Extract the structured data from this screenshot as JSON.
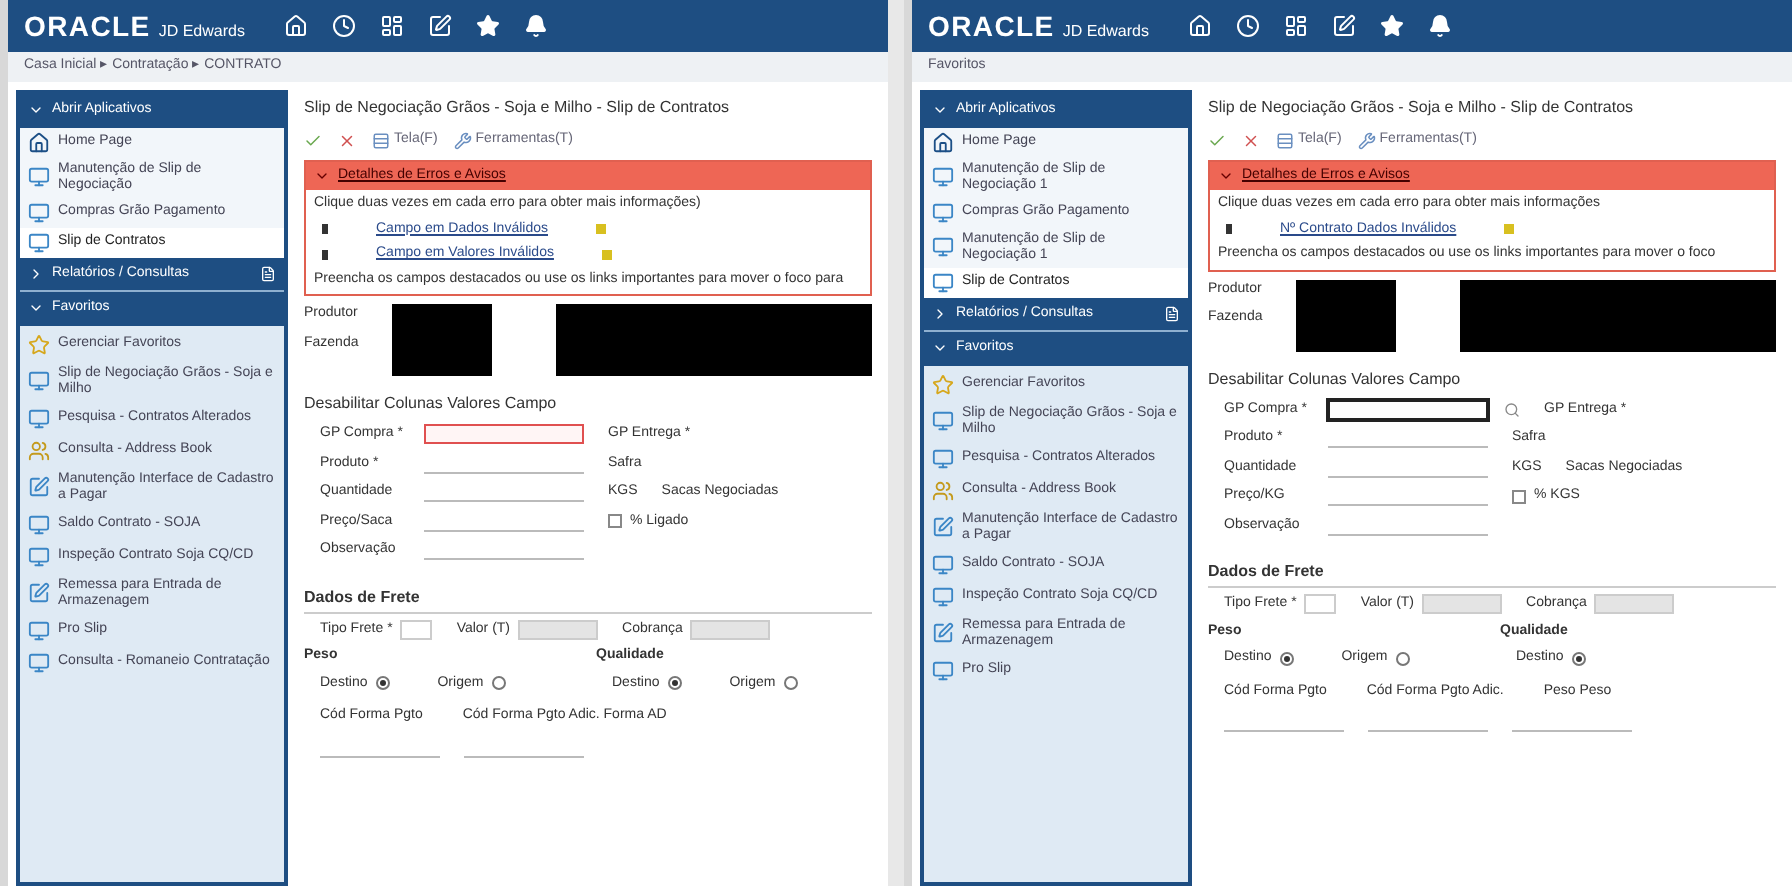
{
  "windows": [
    {
      "logo": {
        "brand": "ORACLE",
        "product": "JD Edwards"
      },
      "breadcrumb": "Casa Inicial ▸ Contratação ▸ CONTRATO",
      "sidebar": {
        "open_apps": {
          "title": "Abrir Aplicativos",
          "items": [
            {
              "label": "Home Page",
              "kind": "home",
              "selected": false
            },
            {
              "label": "Manutenção de Slip de Negociação",
              "kind": "screen",
              "selected": false
            },
            {
              "label": "Compras Grão Pagamento",
              "kind": "screen",
              "selected": false
            },
            {
              "label": "Slip de Contratos",
              "kind": "screen",
              "selected": true
            }
          ]
        },
        "reports": {
          "title": "Relatórios / Consultas"
        },
        "favorites": {
          "title": "Favoritos",
          "items": [
            {
              "label": "Gerenciar Favoritos",
              "kind": "star",
              "selected": false
            },
            {
              "label": "Slip de Negociação Grãos - Soja e Milho",
              "kind": "screen",
              "selected": false
            },
            {
              "label": "Pesquisa - Contratos Alterados",
              "kind": "screen",
              "selected": false
            },
            {
              "label": "Consulta - Address Book",
              "kind": "people",
              "selected": false
            },
            {
              "label": "Manutenção Interface de Cadastro a Pagar",
              "kind": "edit",
              "selected": false
            },
            {
              "label": "Saldo Contrato - SOJA",
              "kind": "screen",
              "selected": false
            },
            {
              "label": "Inspeção Contrato Soja CQ/CD",
              "kind": "screen",
              "selected": false
            },
            {
              "label": "Remessa para Entrada de Armazenagem",
              "kind": "edit",
              "selected": false
            },
            {
              "label": "Pro Slip",
              "kind": "screen",
              "selected": false
            },
            {
              "label": "Consulta - Romaneio Contratação",
              "kind": "screen",
              "selected": false
            }
          ]
        }
      },
      "form": {
        "title": "Slip de Negociação Grãos - Soja e Milho - Slip de Contratos",
        "toolbar": [
          {
            "kind": "ok"
          },
          {
            "kind": "cancel"
          },
          {
            "kind": "screen",
            "label": "Tela(F)"
          },
          {
            "kind": "tools",
            "label": "Ferramentas(T)"
          }
        ],
        "error": {
          "title": "Detalhes de Erros e Avisos",
          "intro": "Clique duas vezes em cada erro para obter mais informações)",
          "links": [
            "Campo em Dados Inválidos",
            "Campo em Valores Inválidos"
          ],
          "footer": "Preencha os campos destacados ou use os links importantes para mover o foco para"
        },
        "party_fields": [
          "Produtor",
          "Fazenda"
        ],
        "section": "Desabilitar Colunas Valores Campo",
        "rows": [
          [
            {
              "kind": "field",
              "label": "GP Compra *",
              "error": true,
              "focused": false
            },
            {
              "kind": "text",
              "label": "GP Entrega *"
            }
          ],
          [
            {
              "kind": "field",
              "label": "Produto *",
              "error": false,
              "focused": false
            },
            {
              "kind": "text",
              "label": "Safra"
            }
          ],
          [
            {
              "kind": "field",
              "label": "Quantidade",
              "error": false,
              "focused": false
            },
            {
              "kind": "text",
              "label": "KGS"
            },
            {
              "kind": "text",
              "label": "Sacas Negociadas"
            }
          ],
          [
            {
              "kind": "field",
              "label": "Preço/Saca",
              "error": false,
              "focused": false
            },
            {
              "kind": "checkbox",
              "label": "% Ligado",
              "checked": false
            }
          ],
          [
            {
              "kind": "field",
              "label": "Observação",
              "error": false,
              "focused": false
            }
          ]
        ],
        "freight": {
          "title": "Dados de Frete",
          "fields": [
            "Tipo Frete *",
            "Valor (T)",
            "Cobrança"
          ],
          "groups": [
            {
              "title": "Peso",
              "options": [
                {
                  "label": "Destino",
                  "selected": true
                },
                {
                  "label": "Origem",
                  "selected": false
                }
              ]
            },
            {
              "title": "Qualidade",
              "options": [
                {
                  "label": "Destino",
                  "selected": true
                },
                {
                  "label": "Origem",
                  "selected": false
                }
              ]
            }
          ],
          "labels": [
            "Cód Forma Pgto",
            "Cód Forma Pgto Adic. Forma AD"
          ]
        }
      }
    },
    {
      "logo": {
        "brand": "ORACLE",
        "product": "JD Edwards"
      },
      "breadcrumb": "Favoritos",
      "sidebar": {
        "open_apps": {
          "title": "Abrir Aplicativos",
          "items": [
            {
              "label": "Home Page",
              "kind": "home",
              "selected": false
            },
            {
              "label": "Manutenção de Slip de Negociação 1",
              "kind": "screen",
              "selected": false
            },
            {
              "label": "Compras Grão Pagamento",
              "kind": "screen",
              "selected": false
            },
            {
              "label": "Manutenção de Slip de Negociação 1",
              "kind": "screen",
              "selected": false
            },
            {
              "label": "Slip de Contratos",
              "kind": "screen",
              "selected": true
            }
          ]
        },
        "reports": {
          "title": "Relatórios / Consultas"
        },
        "favorites": {
          "title": "Favoritos",
          "items": [
            {
              "label": "Gerenciar Favoritos",
              "kind": "star",
              "selected": false
            },
            {
              "label": "Slip de Negociação Grãos - Soja e Milho",
              "kind": "screen",
              "selected": false
            },
            {
              "label": "Pesquisa - Contratos Alterados",
              "kind": "screen",
              "selected": false
            },
            {
              "label": "Consulta - Address Book",
              "kind": "people",
              "selected": false
            },
            {
              "label": "Manutenção Interface de Cadastro a Pagar",
              "kind": "edit",
              "selected": false
            },
            {
              "label": "Saldo Contrato - SOJA",
              "kind": "screen",
              "selected": false
            },
            {
              "label": "Inspeção Contrato Soja CQ/CD",
              "kind": "screen",
              "selected": false
            },
            {
              "label": "Remessa para Entrada de Armazenagem",
              "kind": "edit",
              "selected": false
            },
            {
              "label": "Pro Slip",
              "kind": "screen",
              "selected": false
            }
          ]
        }
      },
      "form": {
        "title": "Slip de Negociação Grãos - Soja e Milho - Slip de Contratos",
        "toolbar": [
          {
            "kind": "ok"
          },
          {
            "kind": "cancel"
          },
          {
            "kind": "screen",
            "label": "Tela(F)"
          },
          {
            "kind": "tools",
            "label": "Ferramentas(T)"
          }
        ],
        "error": {
          "title": "Detalhes de Erros e Avisos",
          "intro": "Clique duas vezes em cada erro para obter mais informações",
          "links": [
            "Nº Contrato Dados Inválidos"
          ],
          "footer": "Preencha os campos destacados ou use os links importantes para mover o foco"
        },
        "party_fields": [
          "Produtor",
          "Fazenda"
        ],
        "section": "Desabilitar Colunas Valores Campo",
        "rows": [
          [
            {
              "kind": "field",
              "label": "GP Compra *",
              "error": false,
              "focused": true
            },
            {
              "kind": "text",
              "label": "GP Entrega *"
            }
          ],
          [
            {
              "kind": "field",
              "label": "Produto *",
              "error": false,
              "focused": false
            },
            {
              "kind": "text",
              "label": "Safra"
            }
          ],
          [
            {
              "kind": "field",
              "label": "Quantidade",
              "error": false,
              "focused": false
            },
            {
              "kind": "text",
              "label": "KGS"
            },
            {
              "kind": "text",
              "label": "Sacas Negociadas"
            }
          ],
          [
            {
              "kind": "field",
              "label": "Preço/KG",
              "error": false,
              "focused": false
            },
            {
              "kind": "checkbox",
              "label": "% KGS",
              "checked": false
            }
          ],
          [
            {
              "kind": "field",
              "label": "Observação",
              "error": false,
              "focused": false
            }
          ]
        ],
        "freight": {
          "title": "Dados de Frete",
          "fields": [
            "Tipo Frete *",
            "Valor (T)",
            "Cobrança"
          ],
          "groups": [
            {
              "title": "Peso",
              "options": [
                {
                  "label": "Destino",
                  "selected": true
                },
                {
                  "label": "Origem",
                  "selected": false
                }
              ]
            },
            {
              "title": "Qualidade",
              "options": [
                {
                  "label": "Destino",
                  "selected": true
                }
              ]
            }
          ],
          "labels": [
            "Cód Forma Pgto",
            "Cód Forma Pgto Adic.",
            "Peso Peso"
          ]
        }
      }
    }
  ]
}
